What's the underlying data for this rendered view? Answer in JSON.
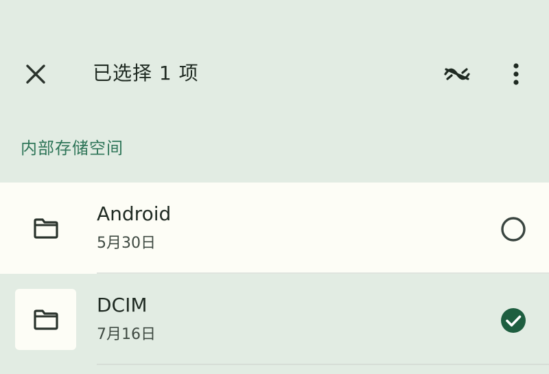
{
  "appbar": {
    "close_icon": "close-icon",
    "title": "已选择 1 项",
    "hide_icon": "eye-off-wave-icon",
    "more_icon": "more-vertical-icon"
  },
  "section": {
    "title": "内部存储空间"
  },
  "files": [
    {
      "name": "Android",
      "date": "5月30日",
      "icon": "folder-icon",
      "selected": false
    },
    {
      "name": "DCIM",
      "date": "7月16日",
      "icon": "folder-icon",
      "selected": true
    }
  ],
  "colors": {
    "background": "#e2ece3",
    "row_background": "#fdfdf6",
    "accent": "#2e7558",
    "checked": "#1e5e40",
    "text": "#1f2a22"
  }
}
